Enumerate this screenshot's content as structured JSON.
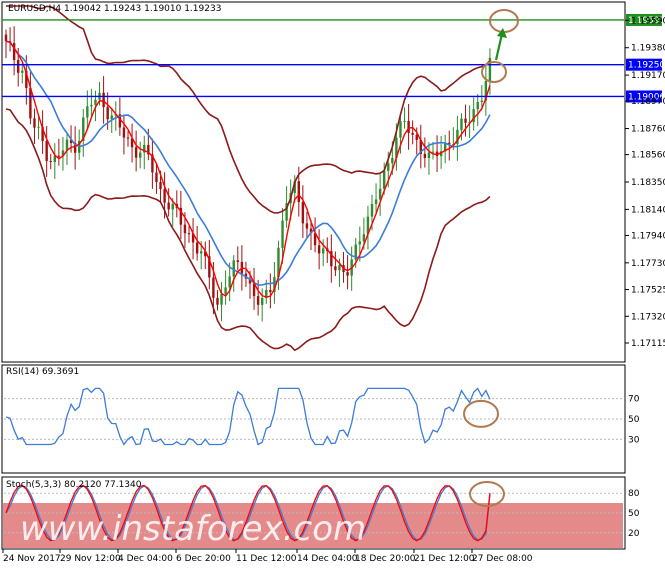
{
  "header": {
    "main": "EURUSD,H4  1.19042  1.19243  1.19010  1.19233",
    "rsi": "RSI(14) 69.3691",
    "stoch": "Stoch(5,3,3) 80.2120 77.1340"
  },
  "watermark": "www.instaforex.com",
  "colors": {
    "bull": "#2e8b2e",
    "bear": "#a01010",
    "ma_fast": "#ff0000",
    "ma_slow": "#3b7dd8",
    "bands": "#8b1a1a",
    "level_blue": "#0000ff",
    "level_green": "#1f8f1f",
    "circle": "#b07a50",
    "watermark_bg": "#e58a8a"
  },
  "chart_data": [
    {
      "type": "candlestick",
      "title": "EURUSD,H4",
      "ylim": [
        1.17,
        1.197
      ],
      "y_ticks": [
        "1.19590",
        "1.19380",
        "1.19170",
        "1.18970",
        "1.18760",
        "1.18560",
        "1.18350",
        "1.18140",
        "1.17940",
        "1.17730",
        "1.17525",
        "1.17320",
        "1.17115"
      ],
      "x_ticks": [
        "24 Nov 2017",
        "29 Nov 12:00",
        "4 Dec 04:00",
        "6 Dec 20:00",
        "11 Dec 12:00",
        "14 Dec 04:00",
        "18 Dec 20:00",
        "21 Dec 12:00",
        "27 Dec 08:00"
      ],
      "levels": [
        {
          "value": 1.19593,
          "label": "1.19593",
          "color": "green"
        },
        {
          "value": 1.1925,
          "label": "1.19250",
          "color": "blue"
        },
        {
          "value": 1.19006,
          "label": "1.19006",
          "color": "blue"
        }
      ],
      "close_path": [
        1.194,
        1.193,
        1.192,
        1.188,
        1.187,
        1.1855,
        1.185,
        1.1865,
        1.186,
        1.188,
        1.1895,
        1.19,
        1.189,
        1.188,
        1.187,
        1.186,
        1.186,
        1.185,
        1.183,
        1.182,
        1.181,
        1.18,
        1.179,
        1.178,
        1.176,
        1.174,
        1.176,
        1.177,
        1.177,
        1.175,
        1.174,
        1.175,
        1.178,
        1.182,
        1.183,
        1.181,
        1.179,
        1.178,
        1.178,
        1.177,
        1.176,
        1.178,
        1.18,
        1.181,
        1.183,
        1.185,
        1.187,
        1.188,
        1.187,
        1.186,
        1.185,
        1.186,
        1.1865,
        1.187,
        1.188,
        1.189,
        1.19,
        1.1923
      ],
      "annotations": [
        "circle at 1.19593 target",
        "circle at 1.19250",
        "arrow up"
      ]
    },
    {
      "type": "line",
      "title": "RSI(14)",
      "value": 69.3691,
      "ylim": [
        0,
        100
      ],
      "levels": [
        70,
        50,
        30
      ],
      "y_ticks": [
        "70",
        "50",
        "30"
      ]
    },
    {
      "type": "line",
      "title": "Stoch(5,3,3)",
      "main": 80.212,
      "signal": 77.134,
      "ylim": [
        0,
        100
      ],
      "levels": [
        80,
        50,
        20
      ],
      "y_ticks": [
        "80",
        "50",
        "20"
      ]
    }
  ]
}
